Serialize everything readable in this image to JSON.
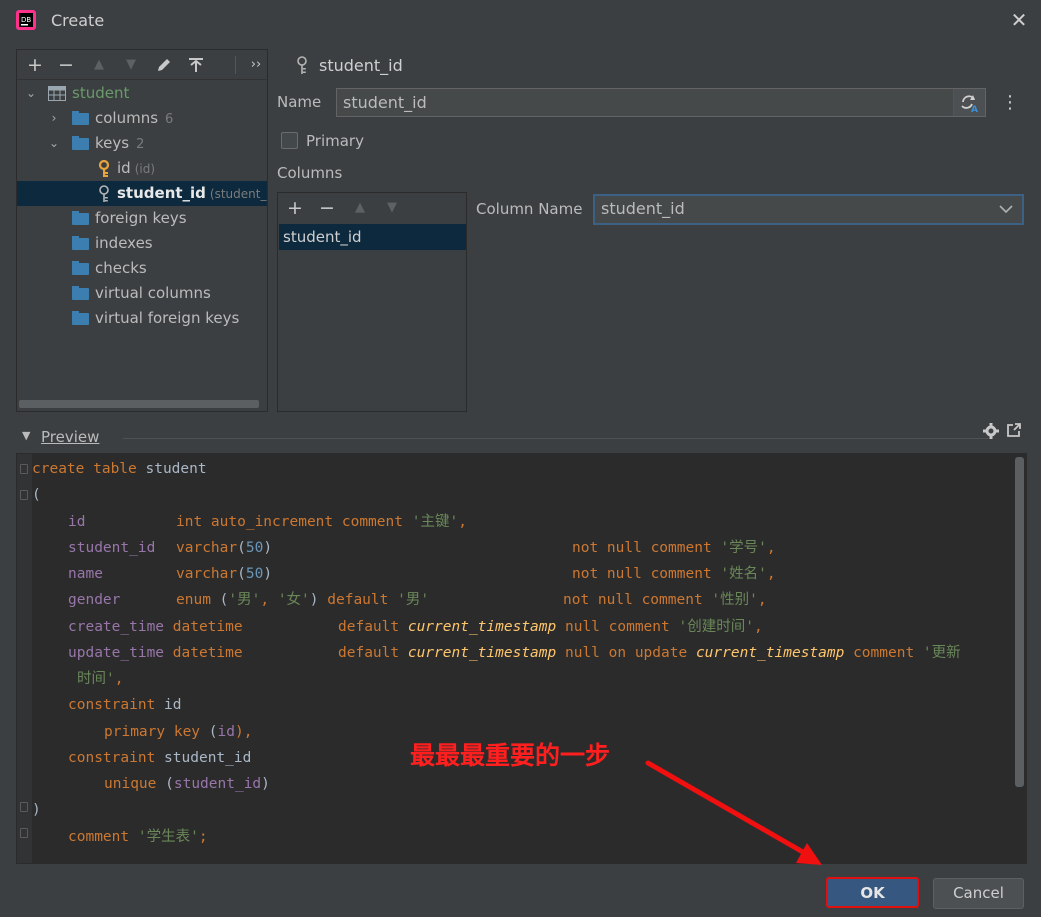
{
  "window": {
    "title": "Create"
  },
  "tree": {
    "root": {
      "label": "student"
    },
    "columns": {
      "label": "columns",
      "count": "6"
    },
    "keys": {
      "label": "keys",
      "count": "2"
    },
    "key_id": {
      "label": "id",
      "hint": "(id)"
    },
    "key_student_id": {
      "label": "student_id",
      "hint": "(student_id"
    },
    "foreign_keys": "foreign keys",
    "indexes": "indexes",
    "checks": "checks",
    "virtual_columns": "virtual columns",
    "virtual_foreign_keys": "virtual foreign keys"
  },
  "editor": {
    "header": "student_id",
    "name_label": "Name",
    "name_value": "student_id",
    "primary_label": "Primary",
    "columns_label": "Columns",
    "column_item": "student_id",
    "column_name_label": "Column Name",
    "column_name_value": "student_id"
  },
  "preview": {
    "label": "Preview"
  },
  "code": {
    "l1a": "create table",
    "l1b": " student",
    "l2": "(",
    "l3a": "id",
    "l3b": "int auto_increment comment",
    "l3c": "'主键'",
    "l3d": ",",
    "l4a": "student_id",
    "l4b": "varchar",
    "l4c": "(",
    "l4d": "50",
    "l4e": ")",
    "l4f": "not null comment",
    "l4g": "'学号'",
    "l4h": ",",
    "l5a": "name",
    "l5b": "varchar",
    "l5c": "(",
    "l5d": "50",
    "l5e": ")",
    "l5f": "not null comment",
    "l5g": "'姓名'",
    "l5h": ",",
    "l6a": "gender",
    "l6b": "enum",
    "l6c": " (",
    "l6d": "'男'",
    "l6e": ", ",
    "l6f": "'女'",
    "l6g": ") ",
    "l6h": "default",
    "l6i": "'男'",
    "l6j": "not null comment",
    "l6k": "'性别'",
    "l6l": ",",
    "l7a": "create_time",
    "l7b": "datetime",
    "l7c": "default",
    "l7d": "current_timestamp",
    "l7e": "null comment",
    "l7f": "'创建时间'",
    "l7g": ",",
    "l8a": "update_time",
    "l8b": "datetime",
    "l8c": "default",
    "l8d": "current_timestamp",
    "l8e": "null on update",
    "l8f": "current_timestamp",
    "l8g": "comment",
    "l8h": "'更新",
    "l9a": "时间'",
    "l9b": ",",
    "l10a": "constraint",
    "l10b": " id",
    "l11a": "primary key",
    "l11b": " (",
    "l11c": "id",
    "l11d": "),",
    "l12a": "constraint",
    "l12b": " student_id",
    "l13a": "unique",
    "l13b": " (",
    "l13c": "student_id",
    "l13d": ")",
    "l14": ")",
    "l15a": "comment",
    "l15b": "'学生表'",
    "l15c": ";"
  },
  "annotation": "最最最重要的一步",
  "buttons": {
    "ok": "OK",
    "cancel": "Cancel"
  },
  "colors": {
    "accent": "#365880",
    "annotation": "#ff1f1f",
    "selection": "#0d293e",
    "folder": "#3d7eb1",
    "key": "#e8a33d"
  },
  "icons": [
    "app-icon",
    "close-icon",
    "add-icon",
    "remove-icon",
    "move-up-icon",
    "move-down-icon",
    "edit-icon",
    "pin-icon",
    "more-icon",
    "table-icon",
    "folder-icon",
    "primary-key-icon",
    "key-icon",
    "refresh-icon",
    "menu-dots-icon",
    "dropdown-icon",
    "gear-icon",
    "external-icon",
    "red-arrow"
  ]
}
